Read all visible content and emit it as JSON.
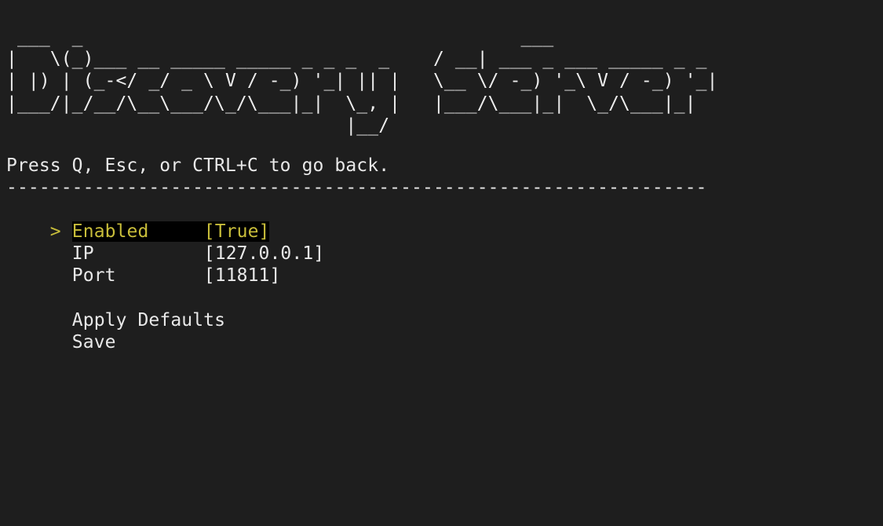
{
  "banner": {
    "ascii_art": " ___  _                                        ___\n|   \\(_)___ __ _____ _____ _ _ _  _    / __| ___ _ ___ _____ _ _\n| |) | (_-</ _/ _ \\ V / -_) '_| || |   \\__ \\/ -_) '_\\ V / -_) '_|\n|___/|_/__/\\__\\___/\\_/\\___|_|  \\_, |   |___/\\___|_|  \\_/\\___|_|\n                               |__/"
  },
  "instruction": "Press Q, Esc, or CTRL+C to go back.",
  "separator": "----------------------------------------------------------------",
  "cursor_symbol": ">",
  "settings": [
    {
      "label": "Enabled",
      "value": "[True]"
    },
    {
      "label": "IP",
      "value": "[127.0.0.1]"
    },
    {
      "label": "Port",
      "value": "[11811]"
    }
  ],
  "actions": {
    "apply_defaults": "Apply Defaults",
    "save": "Save"
  },
  "colors": {
    "background": "#1e1e1e",
    "foreground": "#e8e8e8",
    "selection_text": "#c8bd3a",
    "selection_background": "#000000"
  }
}
